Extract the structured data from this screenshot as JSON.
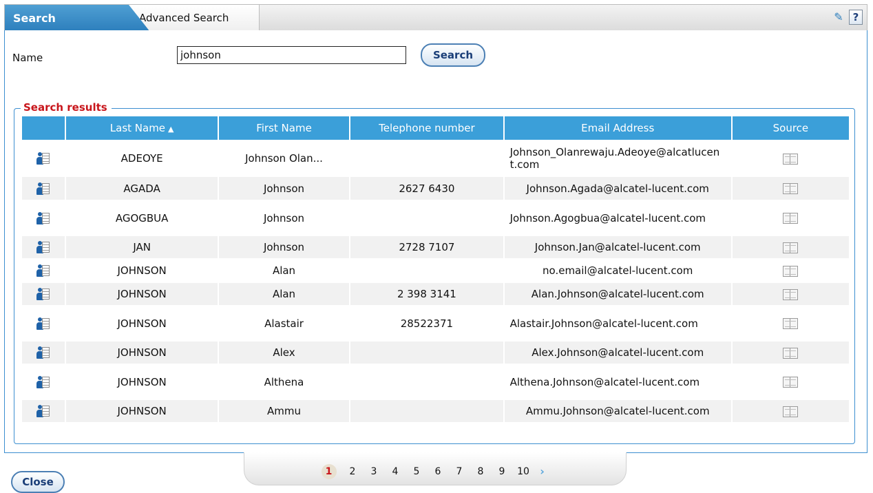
{
  "tabs": {
    "search": "Search",
    "advanced": "Advanced Search"
  },
  "tools": {
    "settings_icon": "tools-icon",
    "help_label": "?"
  },
  "form": {
    "name_label": "Name",
    "name_value": "johnson",
    "search_button": "Search"
  },
  "results": {
    "legend": "Search results",
    "columns": [
      "Last Name",
      "First Name",
      "Telephone number",
      "Email Address",
      "Source"
    ],
    "sort_indicator": "▲",
    "rows": [
      {
        "last": "ADEOYE",
        "first": "Johnson Olan...",
        "phone": "",
        "email": "Johnson_Olanrewaju.Adeoye@alcatlucent.com",
        "wrap": true
      },
      {
        "last": "AGADA",
        "first": "Johnson",
        "phone": "2627 6430",
        "email": "Johnson.Agada@alcatel-lucent.com",
        "wrap": false
      },
      {
        "last": "AGOGBUA",
        "first": "Johnson",
        "phone": "",
        "email": "Johnson.Agogbua@alcatel-lucent.com",
        "wrap": true
      },
      {
        "last": "JAN",
        "first": "Johnson",
        "phone": "2728 7107",
        "email": "Johnson.Jan@alcatel-lucent.com",
        "wrap": false
      },
      {
        "last": "JOHNSON",
        "first": "Alan",
        "phone": "",
        "email": "no.email@alcatel-lucent.com",
        "wrap": false
      },
      {
        "last": "JOHNSON",
        "first": "Alan",
        "phone": "2 398 3141",
        "email": "Alan.Johnson@alcatel-lucent.com",
        "wrap": false
      },
      {
        "last": "JOHNSON",
        "first": "Alastair",
        "phone": "28522371",
        "email": "Alastair.Johnson@alcatel-lucent.com",
        "wrap": true
      },
      {
        "last": "JOHNSON",
        "first": "Alex",
        "phone": "",
        "email": "Alex.Johnson@alcatel-lucent.com",
        "wrap": false
      },
      {
        "last": "JOHNSON",
        "first": "Althena",
        "phone": "",
        "email": "Althena.Johnson@alcatel-lucent.com",
        "wrap": true
      },
      {
        "last": "JOHNSON",
        "first": "Ammu",
        "phone": "",
        "email": "Ammu.Johnson@alcatel-lucent.com",
        "wrap": false
      }
    ]
  },
  "pager": {
    "current": "1",
    "pages": [
      "2",
      "3",
      "4",
      "5",
      "6",
      "7",
      "8",
      "9",
      "10"
    ],
    "next_glyph": "›"
  },
  "close_button": "Close"
}
